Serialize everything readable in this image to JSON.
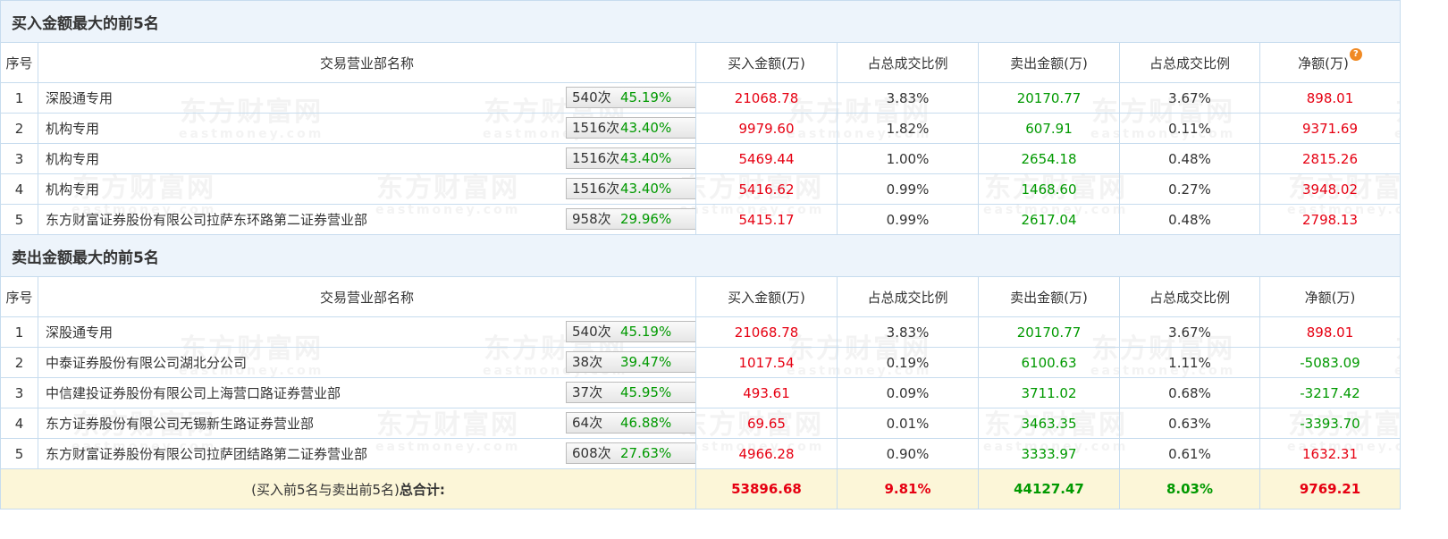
{
  "buy_section": {
    "title": "买入金额最大的前5名",
    "headers": [
      "序号",
      "交易营业部名称",
      "买入金额(万)",
      "占总成交比例",
      "卖出金额(万)",
      "占总成交比例",
      "净额(万)"
    ],
    "rows": [
      {
        "idx": "1",
        "name": "深股通专用",
        "count": "540次",
        "pct": "45.19%",
        "btn": "help",
        "buy": "21068.78",
        "buy_ratio": "3.83%",
        "sell": "20170.77",
        "sell_ratio": "3.67%",
        "net": "898.01",
        "net_sign": "pos"
      },
      {
        "idx": "2",
        "name": "机构专用",
        "count": "1516次",
        "pct": "43.40%",
        "btn": "arrow",
        "buy": "9979.60",
        "buy_ratio": "1.82%",
        "sell": "607.91",
        "sell_ratio": "0.11%",
        "net": "9371.69",
        "net_sign": "pos"
      },
      {
        "idx": "3",
        "name": "机构专用",
        "count": "1516次",
        "pct": "43.40%",
        "btn": "arrow",
        "buy": "5469.44",
        "buy_ratio": "1.00%",
        "sell": "2654.18",
        "sell_ratio": "0.48%",
        "net": "2815.26",
        "net_sign": "pos"
      },
      {
        "idx": "4",
        "name": "机构专用",
        "count": "1516次",
        "pct": "43.40%",
        "btn": "arrow",
        "buy": "5416.62",
        "buy_ratio": "0.99%",
        "sell": "1468.60",
        "sell_ratio": "0.27%",
        "net": "3948.02",
        "net_sign": "pos"
      },
      {
        "idx": "5",
        "name": "东方财富证券股份有限公司拉萨东环路第二证券营业部",
        "count": "958次",
        "pct": "29.96%",
        "btn": "arrow",
        "buy": "5415.17",
        "buy_ratio": "0.99%",
        "sell": "2617.04",
        "sell_ratio": "0.48%",
        "net": "2798.13",
        "net_sign": "pos"
      }
    ]
  },
  "sell_section": {
    "title": "卖出金额最大的前5名",
    "headers": [
      "序号",
      "交易营业部名称",
      "买入金额(万)",
      "占总成交比例",
      "卖出金额(万)",
      "占总成交比例",
      "净额(万)"
    ],
    "rows": [
      {
        "idx": "1",
        "name": "深股通专用",
        "count": "540次",
        "pct": "45.19%",
        "btn": "help",
        "buy": "21068.78",
        "buy_ratio": "3.83%",
        "sell": "20170.77",
        "sell_ratio": "3.67%",
        "net": "898.01",
        "net_sign": "pos"
      },
      {
        "idx": "2",
        "name": "中泰证券股份有限公司湖北分公司",
        "count": "38次",
        "pct": "39.47%",
        "btn": "arrow",
        "buy": "1017.54",
        "buy_ratio": "0.19%",
        "sell": "6100.63",
        "sell_ratio": "1.11%",
        "net": "-5083.09",
        "net_sign": "neg"
      },
      {
        "idx": "3",
        "name": "中信建投证券股份有限公司上海营口路证券营业部",
        "count": "37次",
        "pct": "45.95%",
        "btn": "arrow",
        "buy": "493.61",
        "buy_ratio": "0.09%",
        "sell": "3711.02",
        "sell_ratio": "0.68%",
        "net": "-3217.42",
        "net_sign": "neg"
      },
      {
        "idx": "4",
        "name": "东方证券股份有限公司无锡新生路证券营业部",
        "count": "64次",
        "pct": "46.88%",
        "btn": "arrow",
        "buy": "69.65",
        "buy_ratio": "0.01%",
        "sell": "3463.35",
        "sell_ratio": "0.63%",
        "net": "-3393.70",
        "net_sign": "neg"
      },
      {
        "idx": "5",
        "name": "东方财富证券股份有限公司拉萨团结路第二证券营业部",
        "count": "608次",
        "pct": "27.63%",
        "btn": "arrow",
        "buy": "4966.28",
        "buy_ratio": "0.90%",
        "sell": "3333.97",
        "sell_ratio": "0.61%",
        "net": "1632.31",
        "net_sign": "pos"
      }
    ]
  },
  "total": {
    "label_prefix": "(买入前5名与卖出前5名)",
    "label_bold": "总合计:",
    "buy": "53896.68",
    "buy_ratio": "9.81%",
    "sell": "44127.47",
    "sell_ratio": "8.03%",
    "net": "9769.21"
  },
  "watermark": {
    "brand": "东方财富网",
    "domain": "eastmoney.com"
  },
  "colors": {
    "positive": "#e60012",
    "negative": "#009900",
    "section_bg": "#edf4fb",
    "total_bg": "#fcf6d8",
    "border": "#c7dcee",
    "help_icon": "#f08a24",
    "arrow": "#1a4f8a"
  },
  "icons": {
    "help": "question-mark-icon",
    "arrow": "play-arrow-icon"
  }
}
